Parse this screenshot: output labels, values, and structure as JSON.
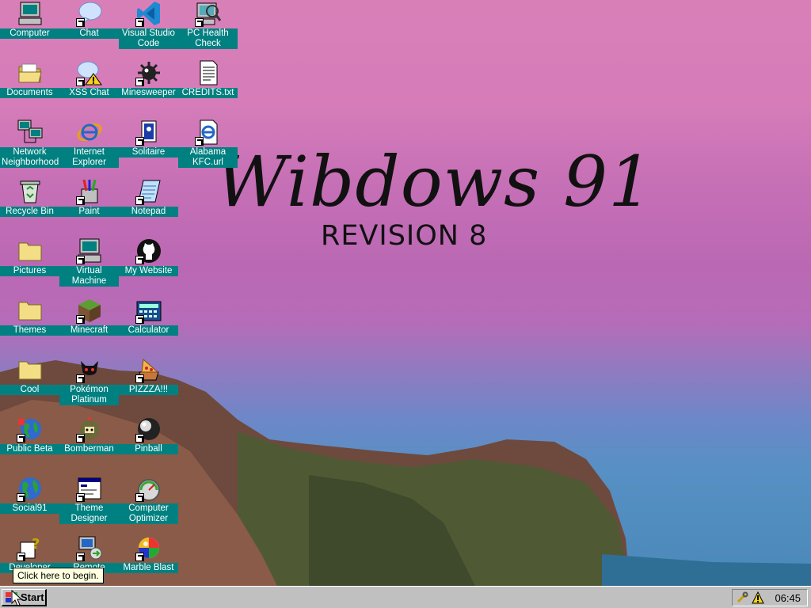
{
  "wallpaper": {
    "title": "Wibdows 91",
    "subtitle": "REVISION 8"
  },
  "icons": [
    {
      "label": "Computer",
      "icon": "computer-icon",
      "shortcut": false
    },
    {
      "label": "Chat",
      "icon": "chat-bubble-icon",
      "shortcut": true
    },
    {
      "label": "Visual Studio Code",
      "icon": "vscode-icon",
      "shortcut": true
    },
    {
      "label": "PC Health Check",
      "icon": "pc-health-icon",
      "shortcut": true
    },
    {
      "label": "Documents",
      "icon": "folder-open-icon",
      "shortcut": false
    },
    {
      "label": "XSS Chat",
      "icon": "xss-chat-icon",
      "shortcut": true
    },
    {
      "label": "Minesweeper",
      "icon": "mine-icon",
      "shortcut": true
    },
    {
      "label": "CREDITS.txt",
      "icon": "text-file-icon",
      "shortcut": false
    },
    {
      "label": "Network Neighborhood",
      "icon": "network-icon",
      "shortcut": false
    },
    {
      "label": "Internet Explorer",
      "icon": "ie-icon",
      "shortcut": false
    },
    {
      "label": "Solitaire",
      "icon": "solitaire-icon",
      "shortcut": true
    },
    {
      "label": "Alabama KFC.url",
      "icon": "ie-url-icon",
      "shortcut": true
    },
    {
      "label": "Recycle Bin",
      "icon": "recycle-bin-icon",
      "shortcut": false
    },
    {
      "label": "Paint",
      "icon": "paint-icon",
      "shortcut": true
    },
    {
      "label": "Notepad",
      "icon": "notepad-icon",
      "shortcut": true
    },
    {
      "label": "Pictures",
      "icon": "folder-icon",
      "shortcut": false
    },
    {
      "label": "Virtual Machine",
      "icon": "vm-icon",
      "shortcut": true
    },
    {
      "label": "My Website",
      "icon": "github-icon",
      "shortcut": true
    },
    {
      "label": "Themes",
      "icon": "folder-icon",
      "shortcut": false
    },
    {
      "label": "Minecraft",
      "icon": "minecraft-icon",
      "shortcut": true
    },
    {
      "label": "Calculator",
      "icon": "calculator-icon",
      "shortcut": true
    },
    {
      "label": "Cool",
      "icon": "folder-icon",
      "shortcut": false
    },
    {
      "label": "Pokémon Platinum",
      "icon": "pokemon-icon",
      "shortcut": true
    },
    {
      "label": "PIZZZA!!!",
      "icon": "pizza-icon",
      "shortcut": true
    },
    {
      "label": "Public Beta",
      "icon": "globe-icon",
      "shortcut": true
    },
    {
      "label": "Bomberman",
      "icon": "bomberman-icon",
      "shortcut": true
    },
    {
      "label": "Pinball",
      "icon": "pinball-icon",
      "shortcut": true
    },
    {
      "label": "Social91",
      "icon": "globe-social-icon",
      "shortcut": true
    },
    {
      "label": "Theme Designer",
      "icon": "window-icon",
      "shortcut": true
    },
    {
      "label": "Computer Optimizer",
      "icon": "gauge-icon",
      "shortcut": true
    },
    {
      "label": "Developer",
      "icon": "help-doc-icon",
      "shortcut": true
    },
    {
      "label": "Remote",
      "icon": "remote-icon",
      "shortcut": true
    },
    {
      "label": "Marble Blast",
      "icon": "marble-icon",
      "shortcut": true
    }
  ],
  "taskbar": {
    "start_label": "Start",
    "clock": "06:45"
  },
  "tooltip": {
    "text": "Click here to begin."
  }
}
